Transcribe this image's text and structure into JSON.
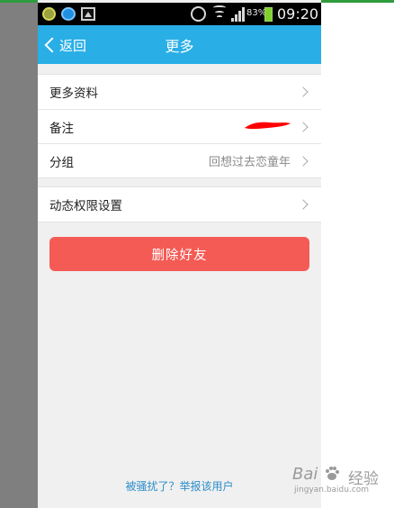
{
  "status_bar": {
    "battery_percent": "83%",
    "time": "09:20",
    "icons": [
      "app-notification-icon",
      "qq-browser-icon",
      "gallery-icon",
      "alarm-icon",
      "wifi-icon",
      "signal-icon",
      "battery-icon"
    ]
  },
  "titlebar": {
    "back_label": "返回",
    "title": "更多"
  },
  "group_1": {
    "items": [
      {
        "label": "更多资料",
        "value": ""
      },
      {
        "label": "备注",
        "value": ""
      },
      {
        "label": "分组",
        "value": "回想过去恋童年"
      }
    ]
  },
  "group_2": {
    "items": [
      {
        "label": "动态权限设置",
        "value": ""
      }
    ]
  },
  "delete_button": {
    "label": "删除好友"
  },
  "report_link": {
    "label": "被骚扰了？举报该用户"
  },
  "watermark": {
    "brand": "Bai",
    "brand_suffix": "经验",
    "url": "jingyan.baidu.com"
  },
  "colors": {
    "title_bar": "#29aee6",
    "delete_button": "#f55b55",
    "link": "#2a8ec9",
    "redaction": "#ff0000"
  }
}
